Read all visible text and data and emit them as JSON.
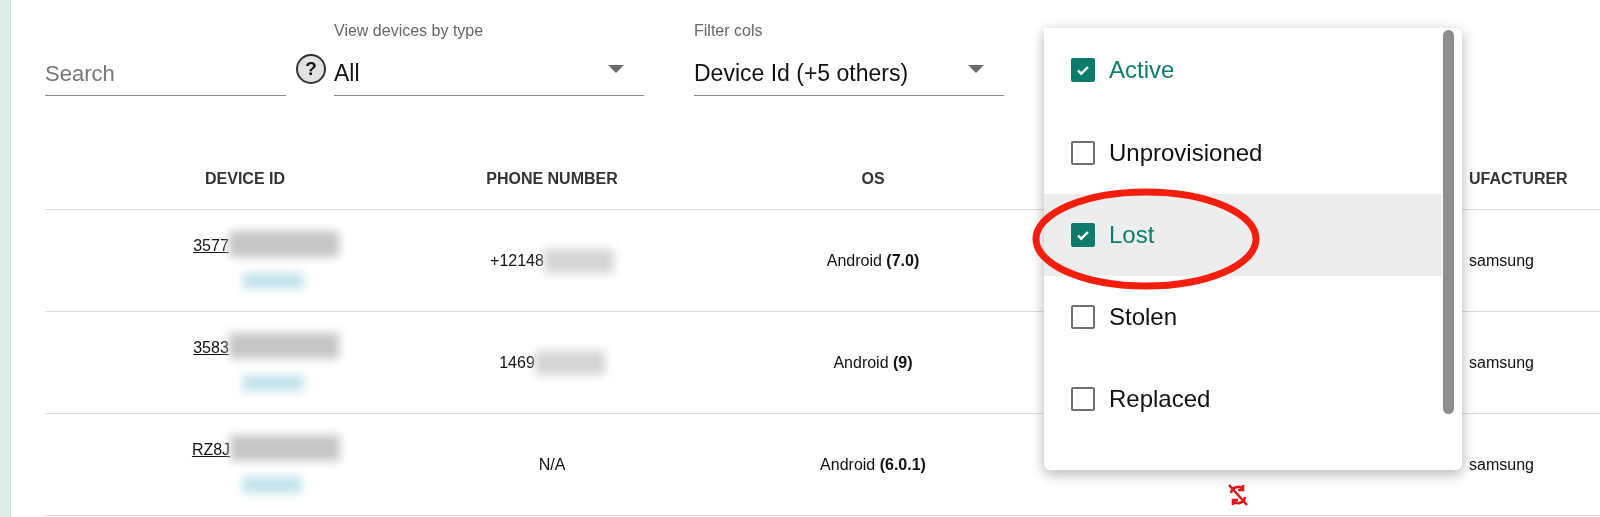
{
  "filters": {
    "search": {
      "placeholder": "Search"
    },
    "help_icon": "?",
    "device_type": {
      "label": "View devices by type",
      "value": "All"
    },
    "columns_filter": {
      "label": "Filter cols",
      "value": "Device Id (+5 others)"
    }
  },
  "table": {
    "columns": [
      "DEVICE ID",
      "PHONE NUMBER",
      "OS",
      "UFACTURER"
    ],
    "rows": [
      {
        "device_id": "3577",
        "phone": "+12148",
        "phone_redacted": true,
        "os": "Android **(7.0)**",
        "manufacturer": "samsung",
        "sync_off": false
      },
      {
        "device_id": "3583",
        "phone": "1469",
        "phone_redacted": true,
        "os": "Android **(9)**",
        "manufacturer": "samsung",
        "sync_off": false
      },
      {
        "device_id": "RZ8J",
        "phone": "N/A",
        "phone_redacted": false,
        "os": "Android **(6.0.1)**",
        "manufacturer": "samsung",
        "sync_off": true
      }
    ]
  },
  "state_menu": {
    "items": [
      {
        "label": "Active",
        "checked": true,
        "selected": false
      },
      {
        "label": "Unprovisioned",
        "checked": false,
        "selected": false
      },
      {
        "label": "Lost",
        "checked": true,
        "selected": true
      },
      {
        "label": "Stolen",
        "checked": false,
        "selected": false
      },
      {
        "label": "Replaced",
        "checked": false,
        "selected": false
      }
    ]
  }
}
